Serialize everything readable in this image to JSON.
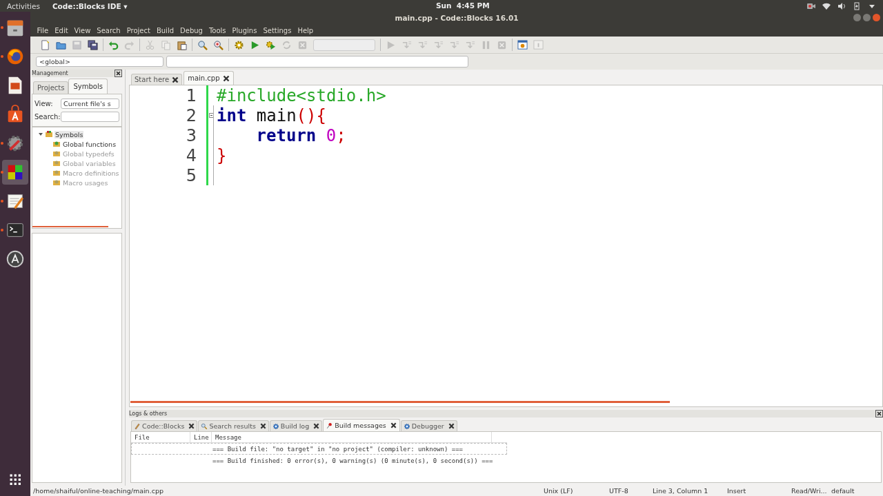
{
  "top_bar": {
    "activities": "Activities",
    "app_menu": "Code::Blocks IDE ▾",
    "clock": "Sun  4:45 PM"
  },
  "dock": [
    {
      "kind": "files",
      "running": true,
      "selected": false
    },
    {
      "kind": "firefox",
      "running": true,
      "selected": false
    },
    {
      "kind": "impress",
      "running": false,
      "selected": false
    },
    {
      "kind": "software",
      "running": false,
      "selected": false
    },
    {
      "kind": "settings",
      "running": true,
      "selected": false
    },
    {
      "kind": "codeblocks",
      "running": true,
      "selected": true
    },
    {
      "kind": "editor",
      "running": true,
      "selected": false
    },
    {
      "kind": "terminal",
      "running": true,
      "selected": false
    },
    {
      "kind": "updater",
      "running": false,
      "selected": false
    },
    {
      "kind": "apps",
      "running": false,
      "selected": false
    }
  ],
  "window": {
    "title": "main.cpp - Code::Blocks 16.01"
  },
  "menu": [
    "File",
    "Edit",
    "View",
    "Search",
    "Project",
    "Build",
    "Debug",
    "Tools",
    "Plugins",
    "Settings",
    "Help"
  ],
  "toolbar": [
    {
      "kind": "new",
      "disabled": false
    },
    {
      "kind": "open",
      "disabled": false
    },
    {
      "kind": "save",
      "disabled": true
    },
    {
      "kind": "save-all",
      "disabled": false
    },
    {
      "kind": "sep"
    },
    {
      "kind": "undo",
      "disabled": false
    },
    {
      "kind": "redo",
      "disabled": true
    },
    {
      "kind": "sep"
    },
    {
      "kind": "cut",
      "disabled": true
    },
    {
      "kind": "copy",
      "disabled": true
    },
    {
      "kind": "paste",
      "disabled": false
    },
    {
      "kind": "sep"
    },
    {
      "kind": "find",
      "disabled": false
    },
    {
      "kind": "replace",
      "disabled": false
    },
    {
      "kind": "sep"
    },
    {
      "kind": "build",
      "disabled": false
    },
    {
      "kind": "run",
      "disabled": false
    },
    {
      "kind": "build-run",
      "disabled": false
    },
    {
      "kind": "rebuild",
      "disabled": true
    },
    {
      "kind": "abort",
      "disabled": true
    },
    {
      "kind": "combo"
    },
    {
      "kind": "sep"
    },
    {
      "kind": "run",
      "disabled": true
    },
    {
      "kind": "step",
      "disabled": true
    },
    {
      "kind": "step",
      "disabled": true
    },
    {
      "kind": "step",
      "disabled": true
    },
    {
      "kind": "step",
      "disabled": true
    },
    {
      "kind": "step",
      "disabled": true
    },
    {
      "kind": "pause",
      "disabled": true
    },
    {
      "kind": "abort",
      "disabled": true
    },
    {
      "kind": "sep"
    },
    {
      "kind": "debug-window",
      "disabled": false
    },
    {
      "kind": "info",
      "disabled": true
    }
  ],
  "scope_bar": {
    "scope": "<global>"
  },
  "management": {
    "title": "Management",
    "tabs": [
      {
        "label": "Projects",
        "selected": false
      },
      {
        "label": "Symbols",
        "selected": true
      }
    ],
    "view_label": "View:",
    "view_value": "Current file's s",
    "search_label": "Search:",
    "tree": [
      {
        "label": "Symbols",
        "expanded": true,
        "selected": true,
        "disabled": false,
        "children": [
          {
            "label": "Global functions",
            "selected": false,
            "disabled": false
          },
          {
            "label": "Global typedefs",
            "selected": false,
            "disabled": true
          },
          {
            "label": "Global variables",
            "selected": false,
            "disabled": true
          },
          {
            "label": "Macro definitions",
            "selected": false,
            "disabled": true
          },
          {
            "label": "Macro usages",
            "selected": false,
            "disabled": true
          }
        ]
      }
    ]
  },
  "editor": {
    "tabs": [
      {
        "label": "Start here",
        "selected": false
      },
      {
        "label": "main.cpp",
        "selected": true
      }
    ],
    "lines": [
      {
        "number": "1",
        "tokens": [
          {
            "kind": "preprocessor",
            "text": "#include<stdio.h>"
          }
        ]
      },
      {
        "number": "2",
        "fold": true,
        "tokens": [
          {
            "kind": "keyword",
            "text": "int"
          },
          {
            "kind": "plain",
            "text": " main"
          },
          {
            "kind": "operator",
            "text": "(){"
          }
        ]
      },
      {
        "number": "3",
        "indented": true,
        "tokens": [
          {
            "kind": "keyword",
            "text": "return"
          },
          {
            "kind": "number",
            "text": " 0"
          },
          {
            "kind": "operator",
            "text": ";"
          }
        ]
      },
      {
        "number": "4",
        "tokens": [
          {
            "kind": "operator",
            "text": "}"
          }
        ]
      },
      {
        "number": "5"
      }
    ]
  },
  "logs": {
    "title": "Logs & others",
    "tabs": [
      {
        "label": "Code::Blocks",
        "kind": "pencil",
        "selected": false
      },
      {
        "label": "Search results",
        "kind": "magnifier",
        "selected": false
      },
      {
        "label": "Build log",
        "kind": "gear",
        "selected": false
      },
      {
        "label": "Build messages",
        "kind": "pin",
        "selected": true
      },
      {
        "label": "Debugger",
        "kind": "gear",
        "selected": false
      }
    ],
    "columns": [
      "File",
      "Line",
      "Message"
    ],
    "rows": [
      {
        "message": "=== Build file: \"no target\" in \"no project\" (compiler: unknown) ===",
        "selected": true
      },
      {
        "message": "=== Build finished: 0 error(s), 0 warning(s) (0 minute(s), 0 second(s)) ===",
        "selected": false
      }
    ]
  },
  "status_bar": {
    "path": "/home/shaiful/online-teaching/main.cpp",
    "eol": "Unix (LF)",
    "encoding": "UTF-8",
    "position": "Line 3, Column 1",
    "mode": "Insert",
    "access": "Read/Wri...",
    "profile": "default"
  }
}
